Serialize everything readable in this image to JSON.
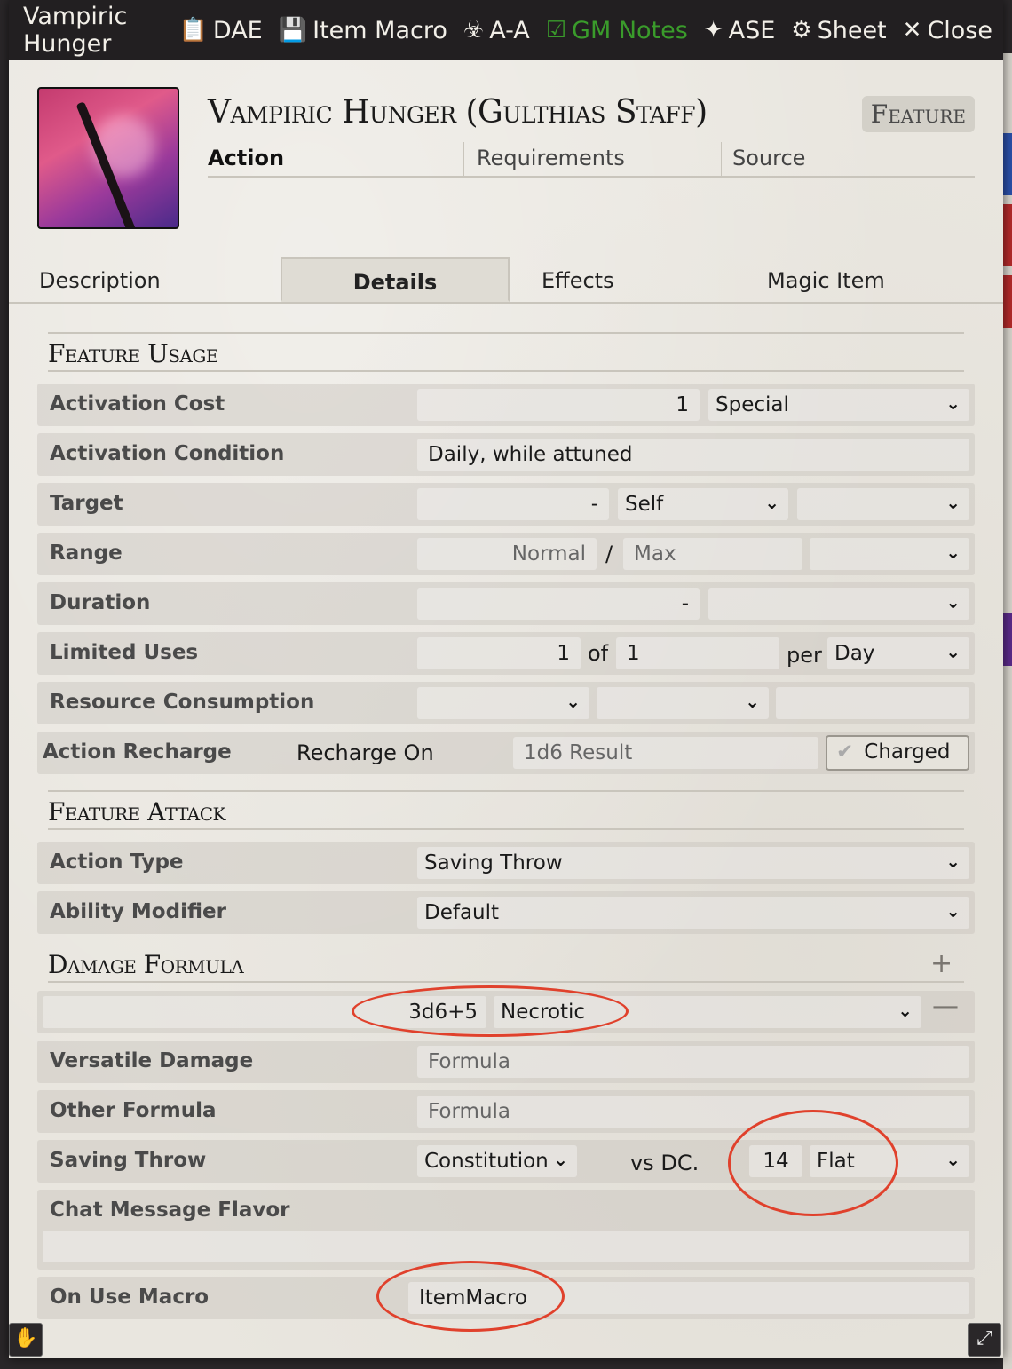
{
  "window": {
    "title": "Vampiric Hunger",
    "buttons": [
      {
        "icon": "clipboard-icon",
        "label": "DAE"
      },
      {
        "icon": "sd-card-icon",
        "label": "Item Macro"
      },
      {
        "icon": "biohazard-icon",
        "label": "A-A"
      },
      {
        "icon": "clipboard-check-icon",
        "label": "GM Notes",
        "color": "#3a9b2b"
      },
      {
        "icon": "magic-wand-icon",
        "label": "ASE"
      },
      {
        "icon": "gear-icon",
        "label": "Sheet"
      },
      {
        "icon": "close-icon",
        "label": "Close"
      }
    ]
  },
  "item": {
    "name": "Vampiric Hunger (Gulthias Staff)",
    "type": "Feature",
    "activation": "Action",
    "requirements": "Requirements",
    "source": "Source"
  },
  "tabs": [
    "Description",
    "Details",
    "Effects",
    "Magic Item"
  ],
  "active_tab": "Details",
  "sections": {
    "usage": "Feature Usage",
    "attack": "Feature Attack",
    "damage": "Damage Formula"
  },
  "usage": {
    "activation_cost": {
      "label": "Activation Cost",
      "value": "1",
      "unit": "Special"
    },
    "activation_condition": {
      "label": "Activation Condition",
      "value": "Daily, while attuned"
    },
    "target": {
      "label": "Target",
      "value": "-",
      "type": "Self",
      "units": ""
    },
    "range": {
      "label": "Range",
      "normal": "Normal",
      "separator": "/",
      "max": "Max",
      "units": ""
    },
    "duration": {
      "label": "Duration",
      "value": "-",
      "units": ""
    },
    "limited_uses": {
      "label": "Limited Uses",
      "value": "1",
      "of": "of",
      "max": "1",
      "per": "per",
      "period": "Day"
    },
    "resource_consumption": {
      "label": "Resource Consumption",
      "type": "",
      "target": "",
      "amount": ""
    },
    "action_recharge": {
      "label": "Action Recharge",
      "recharge_on": "Recharge On",
      "placeholder": "1d6 Result",
      "charged": "Charged"
    }
  },
  "attack": {
    "action_type": {
      "label": "Action Type",
      "value": "Saving Throw"
    },
    "ability_modifier": {
      "label": "Ability Modifier",
      "value": "Default"
    }
  },
  "damage": {
    "formula": "3d6+5",
    "type": "Necrotic",
    "versatile": {
      "label": "Versatile Damage",
      "placeholder": "Formula"
    },
    "other": {
      "label": "Other Formula",
      "placeholder": "Formula"
    },
    "saving_throw": {
      "label": "Saving Throw",
      "ability": "Constitution",
      "vs": "vs DC.",
      "dc": "14",
      "scaling": "Flat"
    },
    "chat_flavor": {
      "label": "Chat Message Flavor",
      "value": ""
    },
    "on_use_macro": {
      "label": "On Use Macro",
      "value": "ItemMacro"
    }
  },
  "colors": {
    "titlebar": "#221f21",
    "gm_notes": "#3a9b2b",
    "annotation": "#e0412c"
  }
}
